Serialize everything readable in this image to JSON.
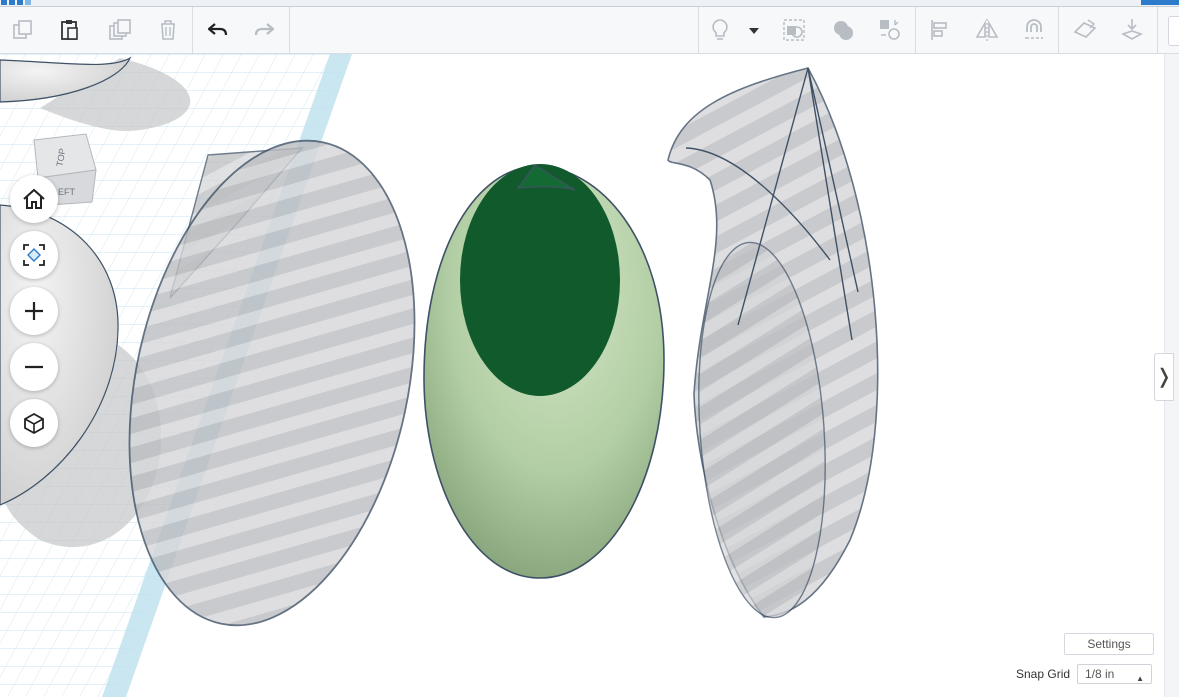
{
  "toolbar": {
    "left_tools": [
      {
        "name": "copy",
        "icon": "copy-icon"
      },
      {
        "name": "paste",
        "icon": "paste-icon"
      },
      {
        "name": "duplicate",
        "icon": "duplicate-icon"
      },
      {
        "name": "delete",
        "icon": "trash-icon"
      },
      {
        "name": "undo",
        "icon": "undo-icon"
      },
      {
        "name": "redo",
        "icon": "redo-icon"
      }
    ],
    "right_tools": [
      {
        "name": "show-all",
        "icon": "lightbulb-icon"
      },
      {
        "name": "show-all-menu",
        "icon": "caret-down-icon"
      },
      {
        "name": "group",
        "icon": "group-icon"
      },
      {
        "name": "ungroup",
        "icon": "ungroup-icon"
      },
      {
        "name": "cruise",
        "icon": "cruise-icon"
      },
      {
        "name": "align",
        "icon": "align-icon"
      },
      {
        "name": "mirror",
        "icon": "mirror-icon"
      },
      {
        "name": "magnet",
        "icon": "magnet-icon"
      },
      {
        "name": "workplane",
        "icon": "workplane-icon"
      },
      {
        "name": "ruler",
        "icon": "ruler-icon"
      }
    ]
  },
  "viewcube": {
    "top_label": "TOP",
    "left_label": "LEFT"
  },
  "nav_controls": [
    {
      "name": "home-view",
      "icon": "home-icon"
    },
    {
      "name": "fit-view",
      "icon": "fit-all-icon"
    },
    {
      "name": "zoom-in",
      "icon": "plus-icon"
    },
    {
      "name": "zoom-out",
      "icon": "minus-icon"
    },
    {
      "name": "projection",
      "icon": "perspective-cube-icon"
    }
  ],
  "settings": {
    "label": "Settings"
  },
  "snap_grid": {
    "label": "Snap Grid",
    "value": "1/8 in"
  },
  "panel_toggle": {
    "glyph": "❭"
  },
  "colors": {
    "solid_green_light": "#c9dfbf",
    "solid_green_dark": "#115a2c",
    "hole_fill": "#bfc1c4",
    "hole_outline": "#3f5166",
    "grid_line": "#cfe8f2",
    "workplane_edge": "#8ccbe2",
    "toolbar_bg": "#f6f8fa",
    "accent": "#2d7ccb"
  }
}
